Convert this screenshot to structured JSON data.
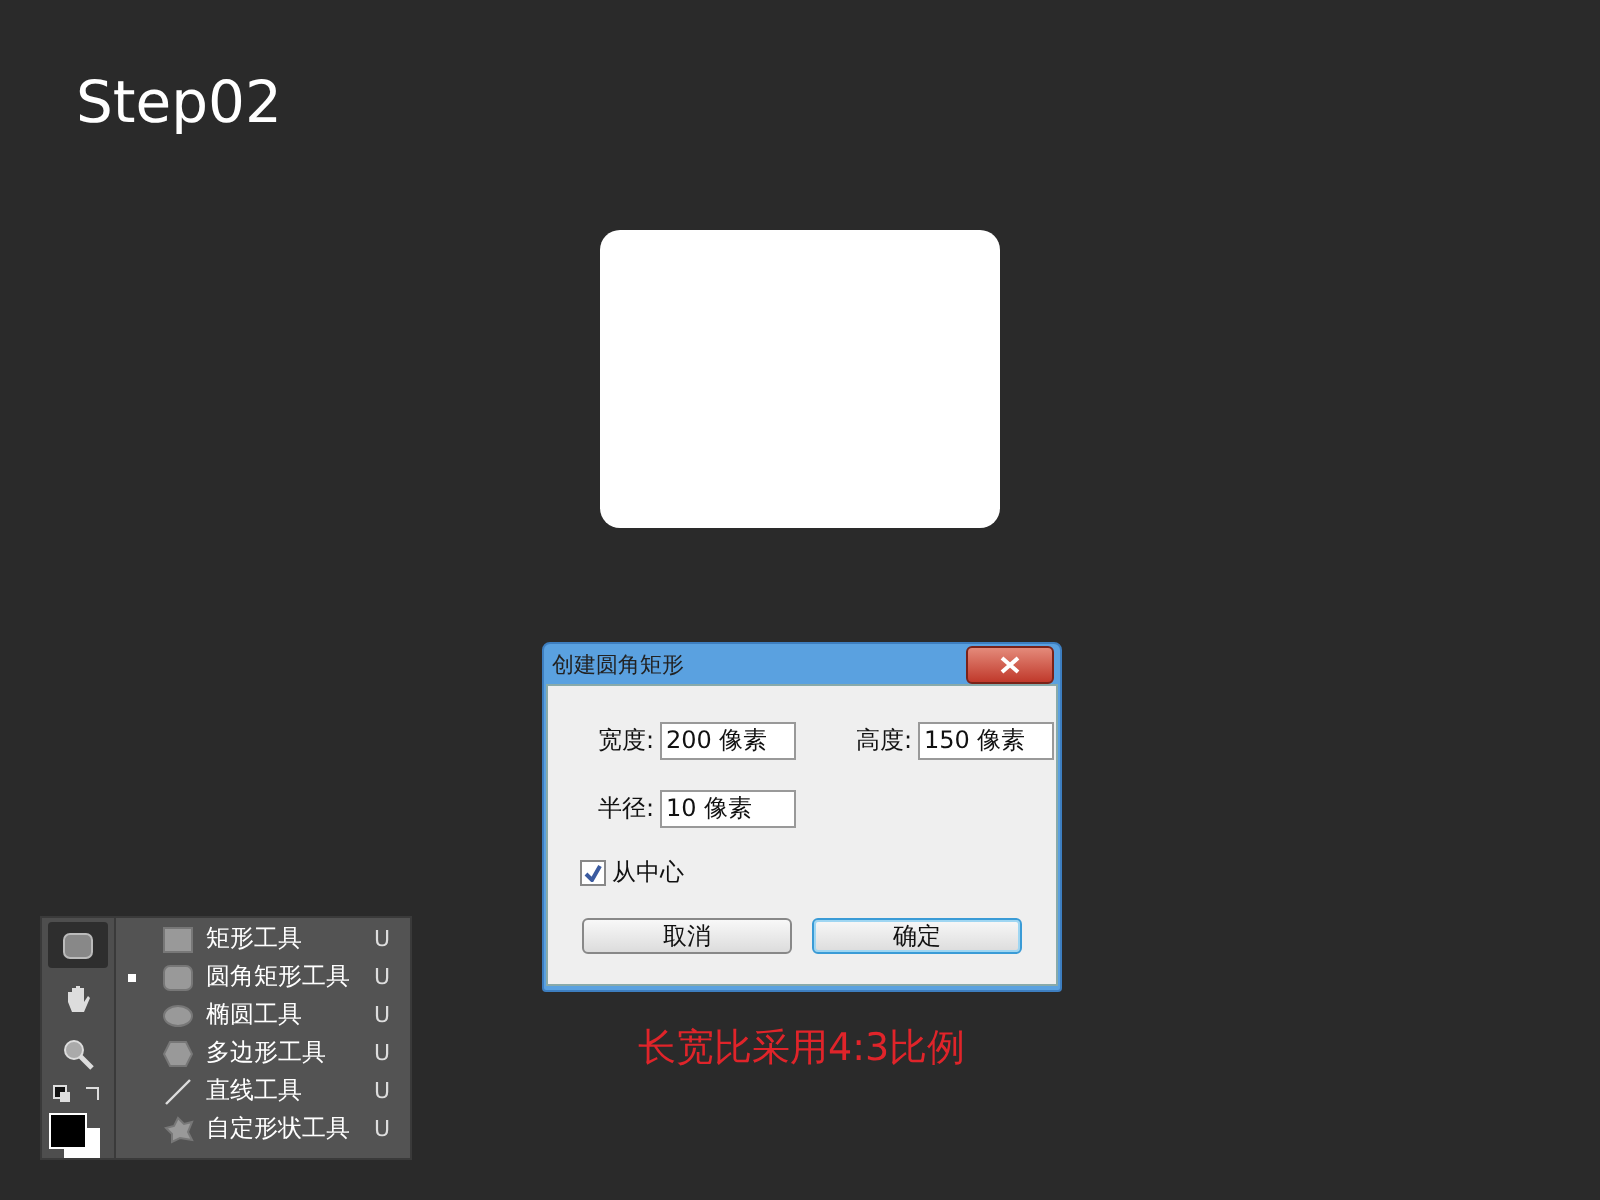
{
  "title": "Step02",
  "dialog": {
    "title": "创建圆角矩形",
    "fields": [
      {
        "label": "宽度:",
        "value": "200 像素"
      },
      {
        "label": "高度:",
        "value": "150 像素"
      },
      {
        "label": "半径:",
        "value": "10 像素"
      }
    ],
    "checkbox": {
      "label": "从中心",
      "checked": true
    },
    "buttons": [
      {
        "label": "取消",
        "selected": false
      },
      {
        "label": "确定",
        "selected": true
      }
    ]
  },
  "caption": "长宽比采用4:3比例",
  "tool_menu": {
    "items": [
      {
        "kind": "rect",
        "label": "矩形工具",
        "shortcut": "U",
        "selected": false
      },
      {
        "kind": "rounded",
        "label": "圆角矩形工具",
        "shortcut": "U",
        "selected": true
      },
      {
        "kind": "ellipse",
        "label": "椭圆工具",
        "shortcut": "U",
        "selected": false
      },
      {
        "kind": "polygon",
        "label": "多边形工具",
        "shortcut": "U",
        "selected": false
      },
      {
        "kind": "line",
        "label": "直线工具",
        "shortcut": "U",
        "selected": false
      },
      {
        "kind": "custom",
        "label": "自定形状工具",
        "shortcut": "U",
        "selected": false
      }
    ]
  }
}
